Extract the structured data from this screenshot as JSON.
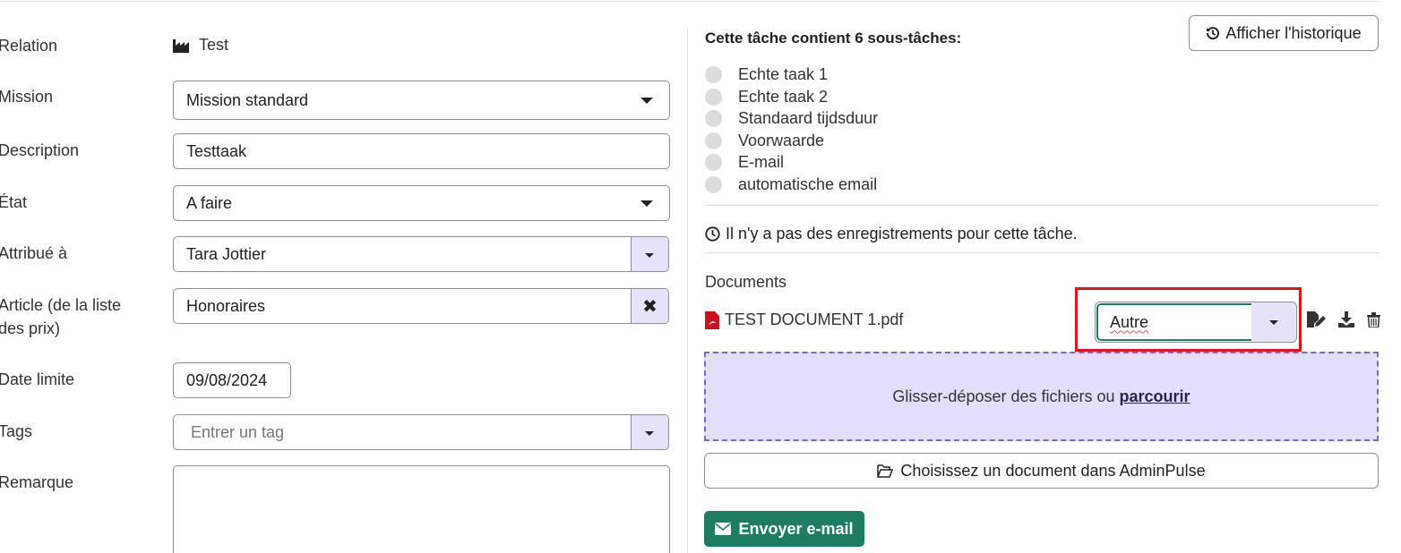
{
  "form": {
    "relation_label": "Relation",
    "relation_value": "Test",
    "mission_label": "Mission",
    "mission_value": "Mission standard",
    "description_label": "Description",
    "description_value": "Testtaak",
    "etat_label": "État",
    "etat_value": "A faire",
    "attribue_label": "Attribué à",
    "attribue_value": "Tara Jottier",
    "article_label_line1": "Article (de la liste",
    "article_label_line2": "des prix)",
    "article_value": "Honoraires",
    "date_label": "Date limite",
    "date_value": "09/08/2024",
    "tags_label": "Tags",
    "tags_placeholder": "Entrer un tag",
    "remarque_label": "Remarque",
    "remarque_value": ""
  },
  "panel": {
    "history_button": "Afficher l'historique",
    "subtasks_title": "Cette tâche contient 6 sous-tâches:",
    "subtasks": [
      "Echte taak 1",
      "Echte taak 2",
      "Standaard tijdsduur",
      "Voorwaarde",
      "E-mail",
      "automatische email"
    ],
    "no_records": "Il n'y a pas des enregistrements pour cette tâche.",
    "documents_title": "Documents",
    "document_name": "TEST DOCUMENT 1.pdf",
    "document_type": "Autre",
    "dropzone_text": "Glisser-déposer des fichiers ou",
    "dropzone_link": "parcourir",
    "adminpulse_button": "Choisissez un document dans AdminPulse",
    "email_button": "Envoyer e-mail"
  },
  "colors": {
    "accent_green": "#1d7d63",
    "addon_lavender": "#e6e2fa",
    "dropzone_bg": "#e3defb",
    "highlight_red": "#e0141e",
    "pdf_red": "#c9141c"
  }
}
